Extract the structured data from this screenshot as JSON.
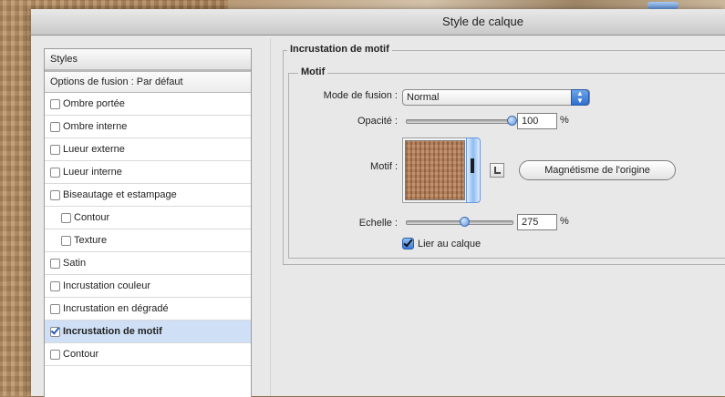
{
  "window": {
    "title": "Style de calque"
  },
  "styles_panel": {
    "header": "Styles",
    "fusion_options": "Options de fusion : Par défaut",
    "items": [
      {
        "label": "Ombre portée",
        "checked": false,
        "sub": false,
        "selected": false
      },
      {
        "label": "Ombre interne",
        "checked": false,
        "sub": false,
        "selected": false
      },
      {
        "label": "Lueur externe",
        "checked": false,
        "sub": false,
        "selected": false
      },
      {
        "label": "Lueur interne",
        "checked": false,
        "sub": false,
        "selected": false
      },
      {
        "label": "Biseautage et estampage",
        "checked": false,
        "sub": false,
        "selected": false
      },
      {
        "label": "Contour",
        "checked": false,
        "sub": true,
        "selected": false
      },
      {
        "label": "Texture",
        "checked": false,
        "sub": true,
        "selected": false
      },
      {
        "label": "Satin",
        "checked": false,
        "sub": false,
        "selected": false
      },
      {
        "label": "Incrustation couleur",
        "checked": false,
        "sub": false,
        "selected": false
      },
      {
        "label": "Incrustation en dégradé",
        "checked": false,
        "sub": false,
        "selected": false
      },
      {
        "label": "Incrustation de motif",
        "checked": true,
        "sub": false,
        "selected": true
      },
      {
        "label": "Contour",
        "checked": false,
        "sub": false,
        "selected": false
      }
    ]
  },
  "pattern_overlay": {
    "group_title": "Incrustation de motif",
    "subgroup_title": "Motif",
    "blend_mode_label": "Mode de fusion :",
    "blend_mode_value": "Normal",
    "opacity_label": "Opacité :",
    "opacity_value": "100",
    "opacity_level": 1.0,
    "opacity_unit": "%",
    "pattern_label": "Motif :",
    "snap_origin_button": "Magnétisme de l'origine",
    "scale_label": "Echelle :",
    "scale_value": "275",
    "scale_level": 0.55,
    "scale_unit": "%",
    "link_layer_label": "Lier au calque",
    "link_layer_checked": true
  },
  "icons": {
    "blend_arrows": "up-down-arrows-icon",
    "new_preset": "new-preset-icon",
    "pattern_picker": "pattern-picker-icon"
  },
  "colors": {
    "selected_row": "#cfe0f6",
    "accent": "#3c7ad8"
  }
}
